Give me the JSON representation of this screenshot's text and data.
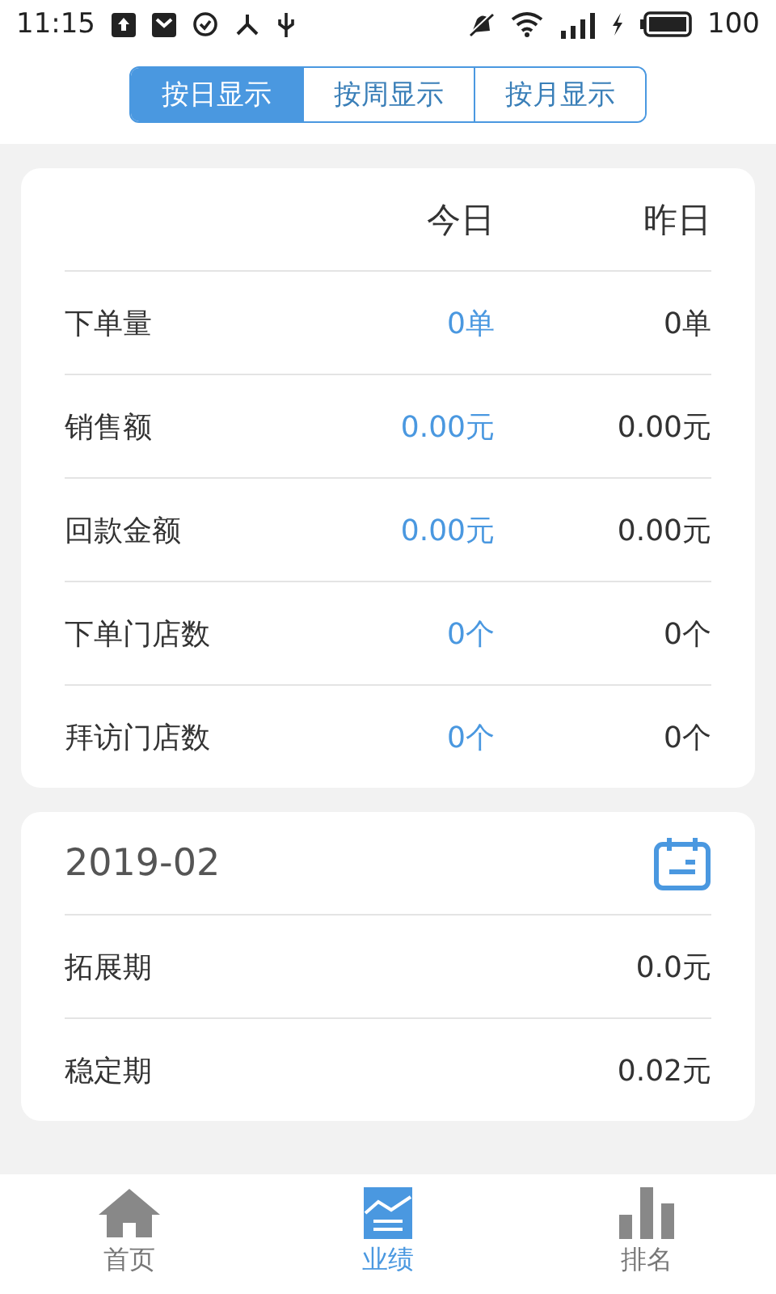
{
  "status_bar": {
    "time": "11:15",
    "battery": "100"
  },
  "segments": [
    {
      "label": "按日显示",
      "selected": true
    },
    {
      "label": "按周显示",
      "selected": false
    },
    {
      "label": "按月显示",
      "selected": false
    }
  ],
  "summary": {
    "columns": [
      "今日",
      "昨日"
    ],
    "rows": [
      {
        "label": "下单量",
        "today": "0单",
        "yesterday": "0单"
      },
      {
        "label": "销售额",
        "today": "0.00元",
        "yesterday": "0.00元"
      },
      {
        "label": "回款金额",
        "today": "0.00元",
        "yesterday": "0.00元"
      },
      {
        "label": "下单门店数",
        "today": "0个",
        "yesterday": "0个"
      },
      {
        "label": "拜访门店数",
        "today": "0个",
        "yesterday": "0个"
      }
    ]
  },
  "monthly": {
    "month": "2019-02",
    "rows": [
      {
        "label": "拓展期",
        "value": "0.0元"
      },
      {
        "label": "稳定期",
        "value": "0.02元"
      }
    ]
  },
  "tab_bar": [
    {
      "label": "首页",
      "kind": "home",
      "selected": false
    },
    {
      "label": "业绩",
      "kind": "chart",
      "selected": true
    },
    {
      "label": "排名",
      "kind": "bars",
      "selected": false
    }
  ]
}
